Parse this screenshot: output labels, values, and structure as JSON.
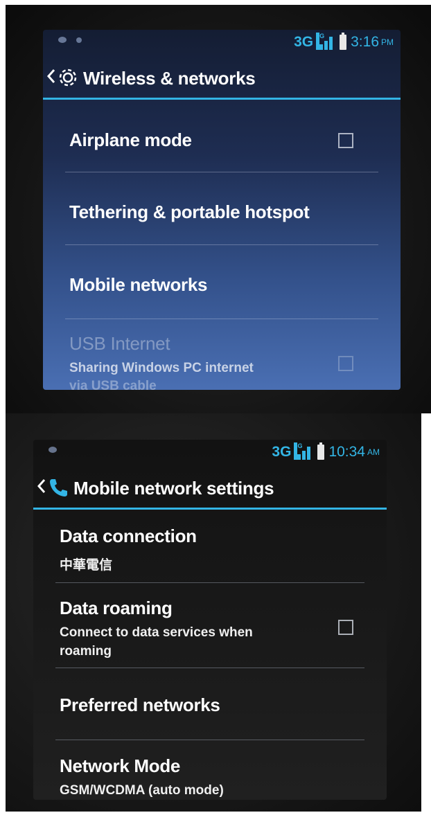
{
  "top_screen": {
    "status_bar": {
      "network_type": "3G",
      "network_sup": "3G",
      "time": "3:16",
      "ampm": "PM"
    },
    "action_bar": {
      "title": "Wireless & networks",
      "icon": "gear-icon"
    },
    "items": [
      {
        "title": "Airplane mode",
        "checked": false
      },
      {
        "title": "Tethering & portable hotspot"
      },
      {
        "title": "Mobile networks"
      },
      {
        "title": "USB Internet",
        "summary": "Sharing Windows PC internet",
        "summary_cut": "via USB cable",
        "enabled": false,
        "checked": false
      }
    ]
  },
  "bottom_screen": {
    "status_bar": {
      "network_type": "3G",
      "network_sup": "3G",
      "time": "10:34",
      "ampm": "AM"
    },
    "action_bar": {
      "title": "Mobile network settings",
      "icon": "phone-icon"
    },
    "items": [
      {
        "title": "Data connection",
        "summary": "中華電信"
      },
      {
        "title": "Data roaming",
        "summary_line1": "Connect to data services when",
        "summary_line2": "roaming",
        "checked": false
      },
      {
        "title": "Preferred networks"
      },
      {
        "title": "Network Mode",
        "summary": "GSM/WCDMA (auto mode)"
      }
    ]
  },
  "colors": {
    "accent": "#33b5e5",
    "text": "#ffffff"
  }
}
